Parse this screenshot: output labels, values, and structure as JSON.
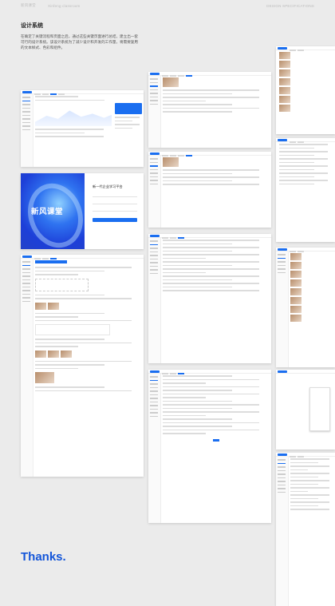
{
  "header": {
    "left": "新风课堂",
    "middle": "Xinfeng classroom",
    "right": "DESIGN SPECIFICATIONS"
  },
  "intro": {
    "title": "设计系统",
    "body": "在确定了关键流程和页面之后，通过这些关键页面进行总结，建立出一套可行的设计系统。该设计系统为了减少设计和开发的工作量，将需要复用的文本样式、色彩和组件。"
  },
  "login": {
    "brand": "新风课堂",
    "form_title": "新一代企业学习平台"
  },
  "footer": {
    "thanks": "Thanks."
  }
}
